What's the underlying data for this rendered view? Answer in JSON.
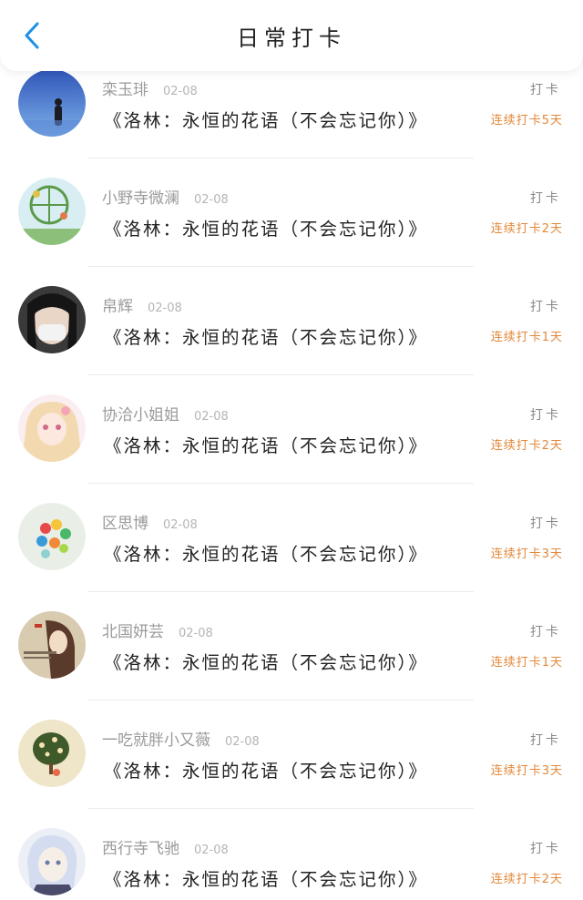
{
  "header": {
    "title": "日常打卡"
  },
  "accent_color": "#1a90e8",
  "streak_color": "#e3883a",
  "rows": [
    {
      "name": "栾玉琲",
      "date": "02-08",
      "book": "《洛林：永恒的花语（不会忘记你）》",
      "action": "打卡",
      "streak": "连续打卡5天"
    },
    {
      "name": "小野寺微澜",
      "date": "02-08",
      "book": "《洛林：永恒的花语（不会忘记你）》",
      "action": "打卡",
      "streak": "连续打卡2天"
    },
    {
      "name": "帛辉",
      "date": "02-08",
      "book": "《洛林：永恒的花语（不会忘记你）》",
      "action": "打卡",
      "streak": "连续打卡1天"
    },
    {
      "name": "协洽小姐姐",
      "date": "02-08",
      "book": "《洛林：永恒的花语（不会忘记你）》",
      "action": "打卡",
      "streak": "连续打卡2天"
    },
    {
      "name": "区思博",
      "date": "02-08",
      "book": "《洛林：永恒的花语（不会忘记你）》",
      "action": "打卡",
      "streak": "连续打卡3天"
    },
    {
      "name": "北国妍芸",
      "date": "02-08",
      "book": "《洛林：永恒的花语（不会忘记你）》",
      "action": "打卡",
      "streak": "连续打卡1天"
    },
    {
      "name": "一吃就胖小又薇",
      "date": "02-08",
      "book": "《洛林：永恒的花语（不会忘记你）》",
      "action": "打卡",
      "streak": "连续打卡3天"
    },
    {
      "name": "西行寺飞驰",
      "date": "02-08",
      "book": "《洛林：永恒的花语（不会忘记你）》",
      "action": "打卡",
      "streak": "连续打卡2天"
    }
  ]
}
